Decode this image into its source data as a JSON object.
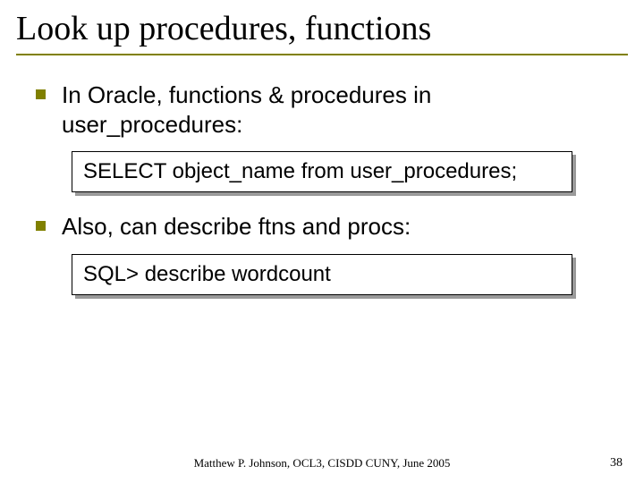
{
  "title": "Look up procedures, functions",
  "bullets": [
    "In Oracle, functions & procedures in user_procedures:",
    "Also, can describe ftns and procs:"
  ],
  "code": [
    "SELECT object_name from user_procedures;",
    "SQL> describe wordcount"
  ],
  "footer": "Matthew P. Johnson, OCL3, CISDD CUNY, June 2005",
  "page": "38"
}
